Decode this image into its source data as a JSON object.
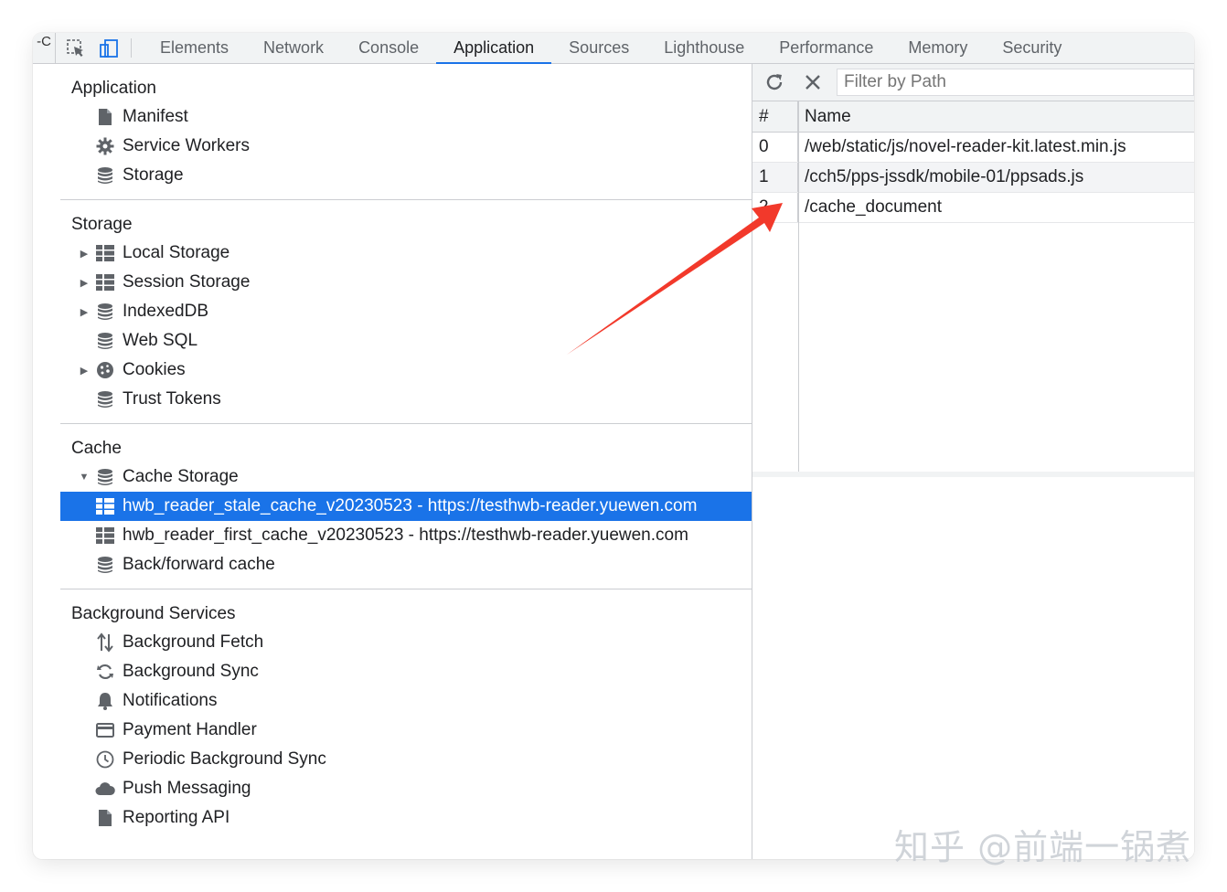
{
  "tabs": {
    "cut_label": "-C",
    "items": [
      "Elements",
      "Network",
      "Console",
      "Application",
      "Sources",
      "Lighthouse",
      "Performance",
      "Memory",
      "Security"
    ],
    "active": "Application"
  },
  "sidebar": {
    "application": {
      "title": "Application",
      "items": [
        {
          "label": "Manifest",
          "icon": "file-icon"
        },
        {
          "label": "Service Workers",
          "icon": "gear-icon"
        },
        {
          "label": "Storage",
          "icon": "database-icon"
        }
      ]
    },
    "storage": {
      "title": "Storage",
      "items": [
        {
          "label": "Local Storage",
          "icon": "table-icon",
          "expandable": true
        },
        {
          "label": "Session Storage",
          "icon": "table-icon",
          "expandable": true
        },
        {
          "label": "IndexedDB",
          "icon": "database-icon",
          "expandable": true
        },
        {
          "label": "Web SQL",
          "icon": "database-icon",
          "expandable": false
        },
        {
          "label": "Cookies",
          "icon": "cookie-icon",
          "expandable": true
        },
        {
          "label": "Trust Tokens",
          "icon": "database-icon",
          "expandable": false
        }
      ]
    },
    "cache": {
      "title": "Cache",
      "cache_storage": "Cache Storage",
      "entries": [
        "hwb_reader_stale_cache_v20230523 - https://testhwb-reader.yuewen.com",
        "hwb_reader_first_cache_v20230523 - https://testhwb-reader.yuewen.com"
      ],
      "back_forward": "Back/forward cache"
    },
    "background": {
      "title": "Background Services",
      "items": [
        {
          "label": "Background Fetch",
          "icon": "fetch-arrows-icon"
        },
        {
          "label": "Background Sync",
          "icon": "sync-icon"
        },
        {
          "label": "Notifications",
          "icon": "bell-icon"
        },
        {
          "label": "Payment Handler",
          "icon": "card-icon"
        },
        {
          "label": "Periodic Background Sync",
          "icon": "clock-icon"
        },
        {
          "label": "Push Messaging",
          "icon": "cloud-icon"
        },
        {
          "label": "Reporting API",
          "icon": "file-icon"
        }
      ]
    }
  },
  "panel": {
    "filter_placeholder": "Filter by Path",
    "columns": [
      "#",
      "Name"
    ],
    "rows": [
      {
        "index": "0",
        "name": "/web/static/js/novel-reader-kit.latest.min.js"
      },
      {
        "index": "1",
        "name": "/cch5/pps-jssdk/mobile-01/ppsads.js"
      },
      {
        "index": "2",
        "name": "/cache_document"
      }
    ]
  },
  "annotation": {
    "arrow_color": "#f2392b"
  },
  "watermark": "知乎 @前端一锅煮"
}
